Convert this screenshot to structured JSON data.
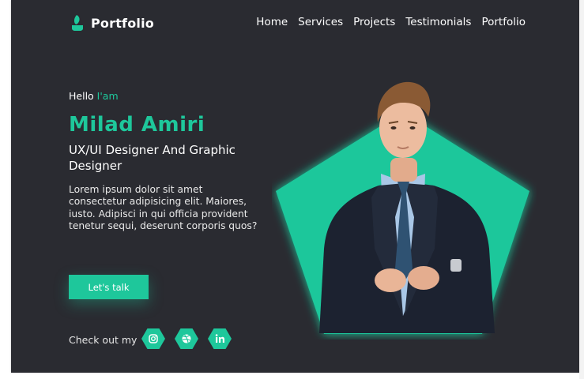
{
  "brand": {
    "name": "Portfolio"
  },
  "nav": {
    "items": [
      "Home",
      "Services",
      "Projects",
      "Testimonials",
      "Portfolio"
    ]
  },
  "hero": {
    "greeting": "Hello",
    "greeting_accent": "I'am",
    "name": "Milad Amiri",
    "role": "UX/UI Designer And Graphic Designer",
    "description": "Lorem ipsum dolor sit amet consectetur adipisicing elit. Maiores, iusto. Adipisci in qui officia provident tenetur sequi, deserunt corporis quos?",
    "cta_label": "Let's talk",
    "checkout_label": "Check out my"
  },
  "social": [
    "instagram-icon",
    "dribbble-icon",
    "linkedin-icon"
  ],
  "colors": {
    "accent": "#1ec79b",
    "background": "#2a2b31",
    "text": "#ffffff"
  }
}
